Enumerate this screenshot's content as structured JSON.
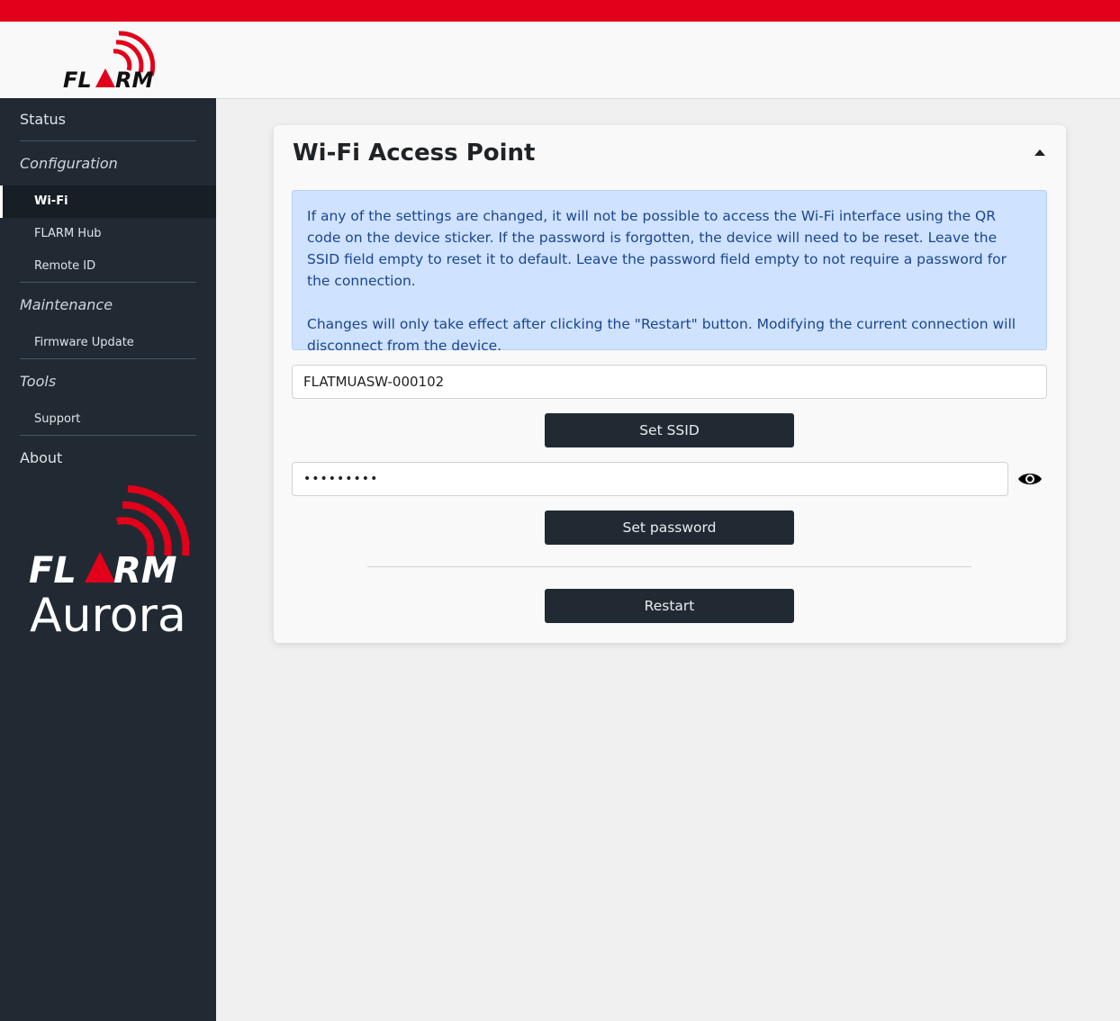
{
  "header": {
    "logo_text": "FLARM"
  },
  "sidebar": {
    "status": "Status",
    "configuration": "Configuration",
    "config_items": [
      "Wi-Fi",
      "FLARM Hub",
      "Remote ID"
    ],
    "maintenance": "Maintenance",
    "maintenance_items": [
      "Firmware Update"
    ],
    "tools": "Tools",
    "tools_items": [
      "Support"
    ],
    "about": "About",
    "product_logo": {
      "brand": "FLARM",
      "product": "Aurora"
    }
  },
  "card": {
    "title": "Wi-Fi Access Point",
    "collapse_icon": "caret-up-icon",
    "alert_p1": "If any of the settings are changed, it will not be possible to access the Wi-Fi interface using the QR code on the device sticker. If the password is forgotten, the device will need to be reset. Leave the SSID field empty to reset it to default. Leave the password field empty to not require a password for the connection.",
    "alert_p2": "Changes will only take effect after clicking the \"Restart\" button. Modifying the current connection will disconnect from the device.",
    "ssid_value": "FLATMUASW-000102",
    "password_value": "•••••••••",
    "set_ssid_label": "Set SSID",
    "set_password_label": "Set password",
    "restart_label": "Restart",
    "eye_icon": "eye-icon"
  },
  "colors": {
    "accent_red": "#e2001a",
    "sidebar_bg": "#212a33",
    "alert_bg": "#cfe2ff",
    "alert_text": "#1a4590",
    "button_bg": "#212a33"
  }
}
